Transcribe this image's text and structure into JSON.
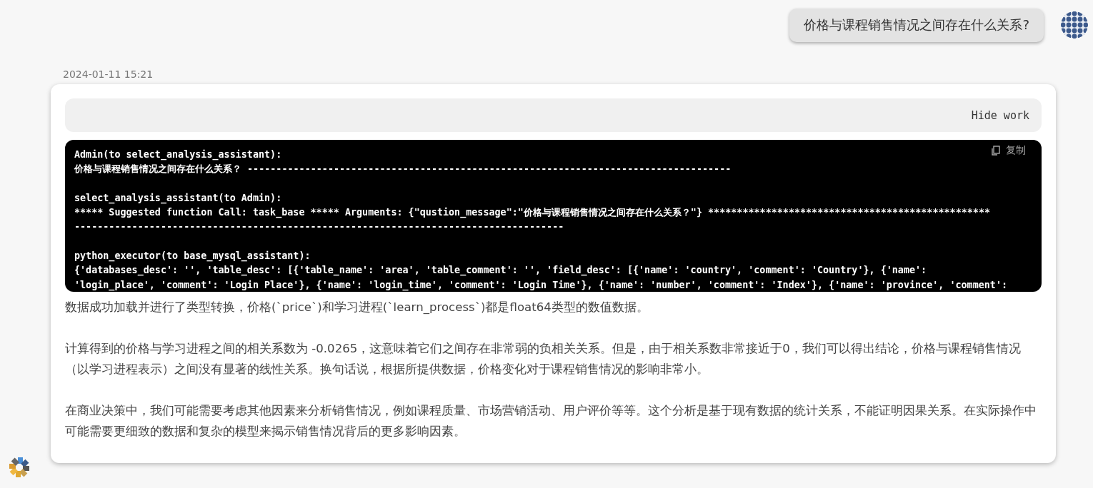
{
  "user_message": {
    "text": "价格与课程销售情况之间存在什么关系?"
  },
  "timestamp": "2024-01-11 15:21",
  "work_toggle": {
    "label": "Hide work"
  },
  "code_block": {
    "copy_label": "复制",
    "blocks": [
      [
        "Admin(to select_analysis_assistant):",
        "价格与课程销售情况之间存在什么关系？ ------------------------------------------------------------------------------------"
      ],
      [
        "select_analysis_assistant(to Admin):",
        "***** Suggested function Call: task_base ***** Arguments: {\"qustion_message\":\"价格与课程销售情况之间存在什么关系？\"} *************************************************",
        "-------------------------------------------------------------------------------------"
      ],
      [
        "python_executor(to base_mysql_assistant):",
        "{'databases_desc': '', 'table_desc': [{'table_name': 'area', 'table_comment': '', 'field_desc': [{'name': 'country', 'comment': 'Country'}, {'name':",
        "'login_place', 'comment': 'Login Place'}, {'name': 'login_time', 'comment': 'Login Time'}, {'name': 'number', 'comment': 'Index'}, {'name': 'province', 'comment':"
      ]
    ]
  },
  "paragraphs": [
    "数据成功加载并进行了类型转换，价格(`price`)和学习进程(`learn_process`)都是float64类型的数值数据。",
    "计算得到的价格与学习进程之间的相关系数为 -0.0265，这意味着它们之间存在非常弱的负相关关系。但是，由于相关系数非常接近于0，我们可以得出结论，价格与课程销售情况（以学习进程表示）之间没有显著的线性关系。换句话说，根据所提供数据，价格变化对于课程销售情况的影响非常小。",
    "在商业决策中，我们可能需要考虑其他因素来分析销售情况，例如课程质量、市场营销活动、用户评价等等。这个分析是基于现有数据的统计关系，不能证明因果关系。在实际操作中可能需要更细致的数据和复杂的模型来揭示销售情况背后的更多影响因素。"
  ]
}
